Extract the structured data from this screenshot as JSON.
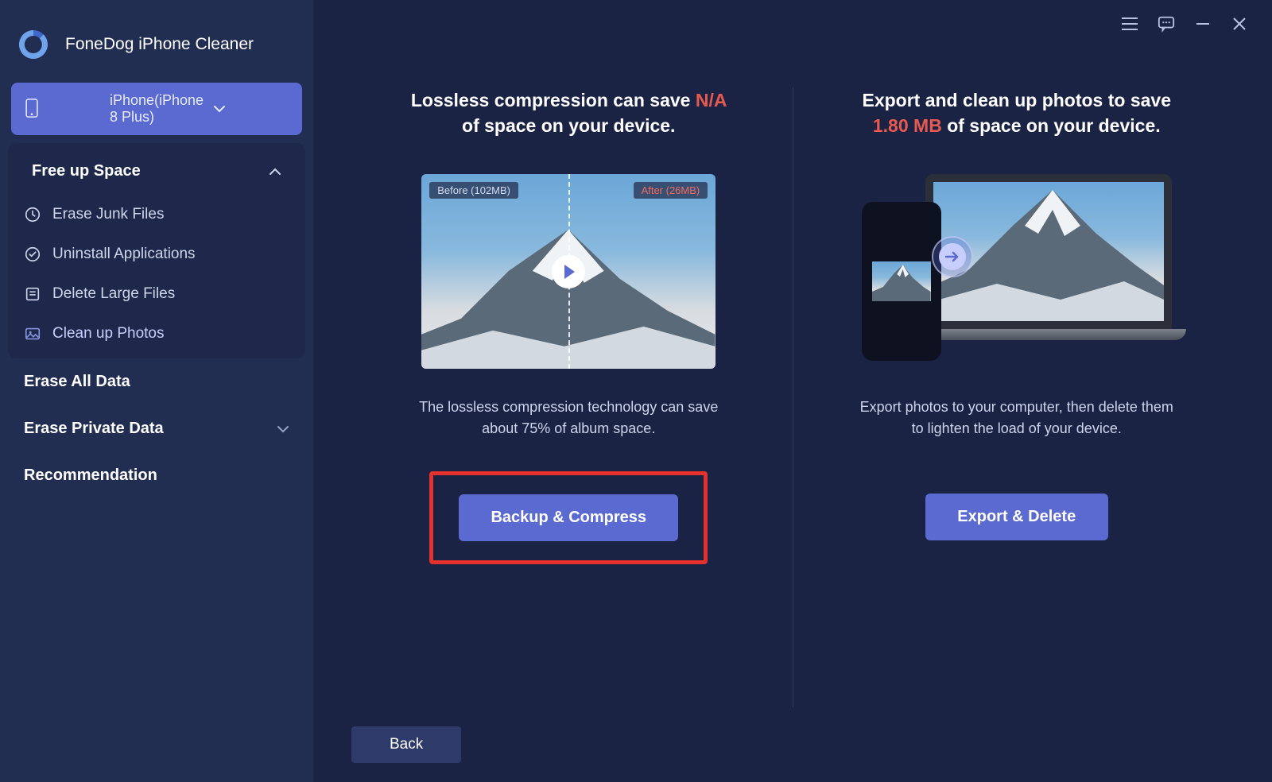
{
  "app": {
    "title": "FoneDog iPhone Cleaner"
  },
  "device": {
    "label": "iPhone(iPhone 8 Plus)"
  },
  "sidebar": {
    "free_up_space": {
      "label": "Free up Space"
    },
    "items": [
      {
        "label": "Erase Junk Files"
      },
      {
        "label": "Uninstall Applications"
      },
      {
        "label": "Delete Large Files"
      },
      {
        "label": "Clean up Photos"
      }
    ],
    "erase_all": {
      "label": "Erase All Data"
    },
    "erase_private": {
      "label": "Erase Private Data"
    },
    "recommendation": {
      "label": "Recommendation"
    }
  },
  "compress": {
    "heading_pre": "Lossless compression can save ",
    "heading_em": "N/A",
    "heading_post": " of space on your device.",
    "before_label": "Before (102MB)",
    "after_label": "After (26MB)",
    "desc": "The lossless compression technology can save about 75% of album space.",
    "button": "Backup & Compress"
  },
  "export": {
    "heading_pre": "Export and clean up photos to save ",
    "heading_em": "1.80 MB",
    "heading_post": " of space on your device.",
    "desc": "Export photos to your computer, then delete them to lighten the load of your device.",
    "button": "Export & Delete"
  },
  "footer": {
    "back": "Back"
  }
}
